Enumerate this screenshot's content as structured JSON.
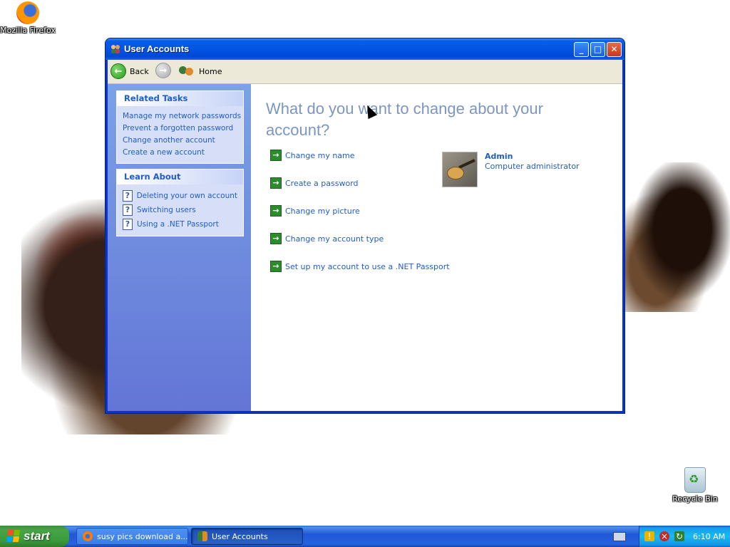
{
  "desktop": {
    "icons": [
      {
        "label": "Mozilla Firefox"
      },
      {
        "label": "Recycle Bin"
      }
    ]
  },
  "window": {
    "title": "User Accounts",
    "controls": {
      "minimize": "_",
      "maximize": "□",
      "close": "✕"
    }
  },
  "toolbar": {
    "back_label": "Back",
    "home_label": "Home"
  },
  "sidebar": {
    "related_tasks": {
      "title": "Related Tasks",
      "items": [
        {
          "label": "Manage my network passwords"
        },
        {
          "label": "Prevent a forgotten password"
        },
        {
          "label": "Change another account"
        },
        {
          "label": "Create a new account"
        }
      ]
    },
    "learn_about": {
      "title": "Learn About",
      "items": [
        {
          "label": "Deleting your own account"
        },
        {
          "label": "Switching users"
        },
        {
          "label": "Using a .NET Passport"
        }
      ]
    }
  },
  "main": {
    "heading": "What do you want to change about your account?",
    "tasks": [
      {
        "label": "Change my name"
      },
      {
        "label": "Create a password"
      },
      {
        "label": "Change my picture"
      },
      {
        "label": "Change my account type"
      },
      {
        "label": "Set up my account to use a .NET Passport"
      }
    ],
    "user": {
      "name": "Admin",
      "role": "Computer administrator"
    }
  },
  "taskbar": {
    "start_label": "start",
    "buttons": [
      {
        "label": "susy pics download a..."
      },
      {
        "label": "User Accounts"
      }
    ],
    "clock": "6:10 AM"
  },
  "colors": {
    "accent": "#215dc6",
    "taskpane": "#6375d6",
    "heading": "#7c96c2",
    "titlebar": "#0254e3",
    "start": "#3b9a3b"
  }
}
